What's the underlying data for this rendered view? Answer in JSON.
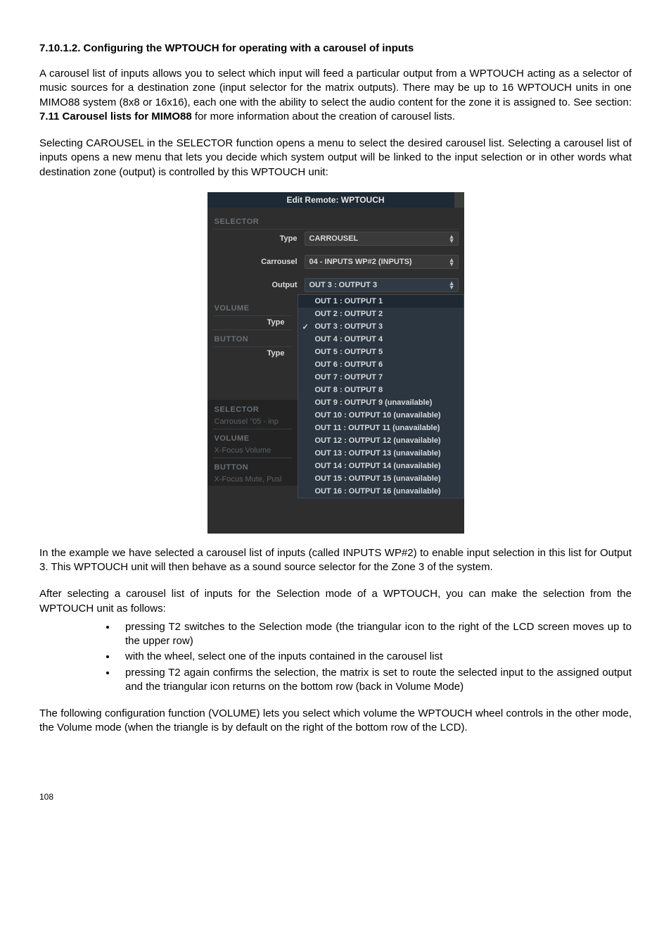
{
  "heading": "7.10.1.2. Configuring the WPTOUCH for operating with a carousel of inputs",
  "p1_a": "A carousel list of inputs allows you to select which input will feed a particular output from a WPTOUCH acting as a selector of music sources for a destination zone (input selector for the matrix outputs). There may be up to 16 WPTOUCH units in one MIMO88 system (8x8 or 16x16), each one with the ability to select the audio content for the zone it is assigned to. See section: ",
  "p1_bold": "7.11 Carousel lists for MIMO88",
  "p1_b": " for more information about the creation of carousel lists.",
  "p2": "Selecting CAROUSEL in the SELECTOR function opens a menu to select the desired carousel list. Selecting a carousel list of inputs opens a new menu that lets you decide which system output will be linked to the input selection or in other words what destination zone (output) is controlled by this WPTOUCH unit:",
  "p3": "In the example we have selected a carousel list of inputs (called INPUTS WP#2) to enable input selection in this list for Output 3. This WPTOUCH unit will then behave as a sound source selector for the Zone 3 of the system.",
  "p4": "After selecting a carousel list of inputs for the Selection mode of a WPTOUCH, you can make the selection from the WPTOUCH unit as follows:",
  "b1": "pressing T2 switches to the Selection mode (the triangular icon to the right of the LCD screen moves up to the upper row)",
  "b2": "with the wheel, select one of the inputs contained in the carousel list",
  "b3": "pressing T2 again confirms the selection, the matrix is set to route the selected input to the assigned output and the triangular icon returns on the bottom row (back in Volume Mode)",
  "p5": "The following configuration function (VOLUME) lets you select which volume the WPTOUCH wheel controls in the other mode, the Volume mode (when the triangle is by default on the right of the bottom row of the LCD).",
  "page_num": "108",
  "dlg": {
    "title": "Edit Remote: WPTOUCH",
    "selector_head": "SELECTOR",
    "type_lbl": "Type",
    "type_val": "CARROUSEL",
    "carrousel_lbl": "Carrousel",
    "carrousel_val": "04 - INPUTS WP#2 (INPUTS)",
    "output_lbl": "Output",
    "output_val": "OUT 3 : OUTPUT 3",
    "volume_head": "VOLUME",
    "button_head": "BUTTON",
    "selector_head2": "SELECTOR",
    "selector_sub": "Carrousel \"05 - inp",
    "volume_head2": "VOLUME",
    "volume_sub": "X-Focus Volume",
    "button_head2": "BUTTON",
    "button_sub": "X-Focus Mute, Pusl"
  },
  "dropdown": [
    {
      "t": "OUT 1 : OUTPUT 1",
      "hl": true
    },
    {
      "t": "OUT 2 : OUTPUT 2"
    },
    {
      "t": "OUT 3 : OUTPUT 3",
      "check": true
    },
    {
      "t": "OUT 4 : OUTPUT 4"
    },
    {
      "t": "OUT 5 : OUTPUT 5"
    },
    {
      "t": "OUT 6 : OUTPUT 6"
    },
    {
      "t": "OUT 7 : OUTPUT 7"
    },
    {
      "t": "OUT 8 : OUTPUT 8"
    },
    {
      "t": "OUT 9 : OUTPUT 9 (unavailable)"
    },
    {
      "t": "OUT 10 : OUTPUT 10 (unavailable)"
    },
    {
      "t": "OUT 11 : OUTPUT 11 (unavailable)"
    },
    {
      "t": "OUT 12 : OUTPUT 12 (unavailable)"
    },
    {
      "t": "OUT 13 : OUTPUT 13 (unavailable)"
    },
    {
      "t": "OUT 14 : OUTPUT 14 (unavailable)"
    },
    {
      "t": "OUT 15 : OUTPUT 15 (unavailable)"
    },
    {
      "t": "OUT 16 : OUTPUT 16 (unavailable)"
    }
  ]
}
